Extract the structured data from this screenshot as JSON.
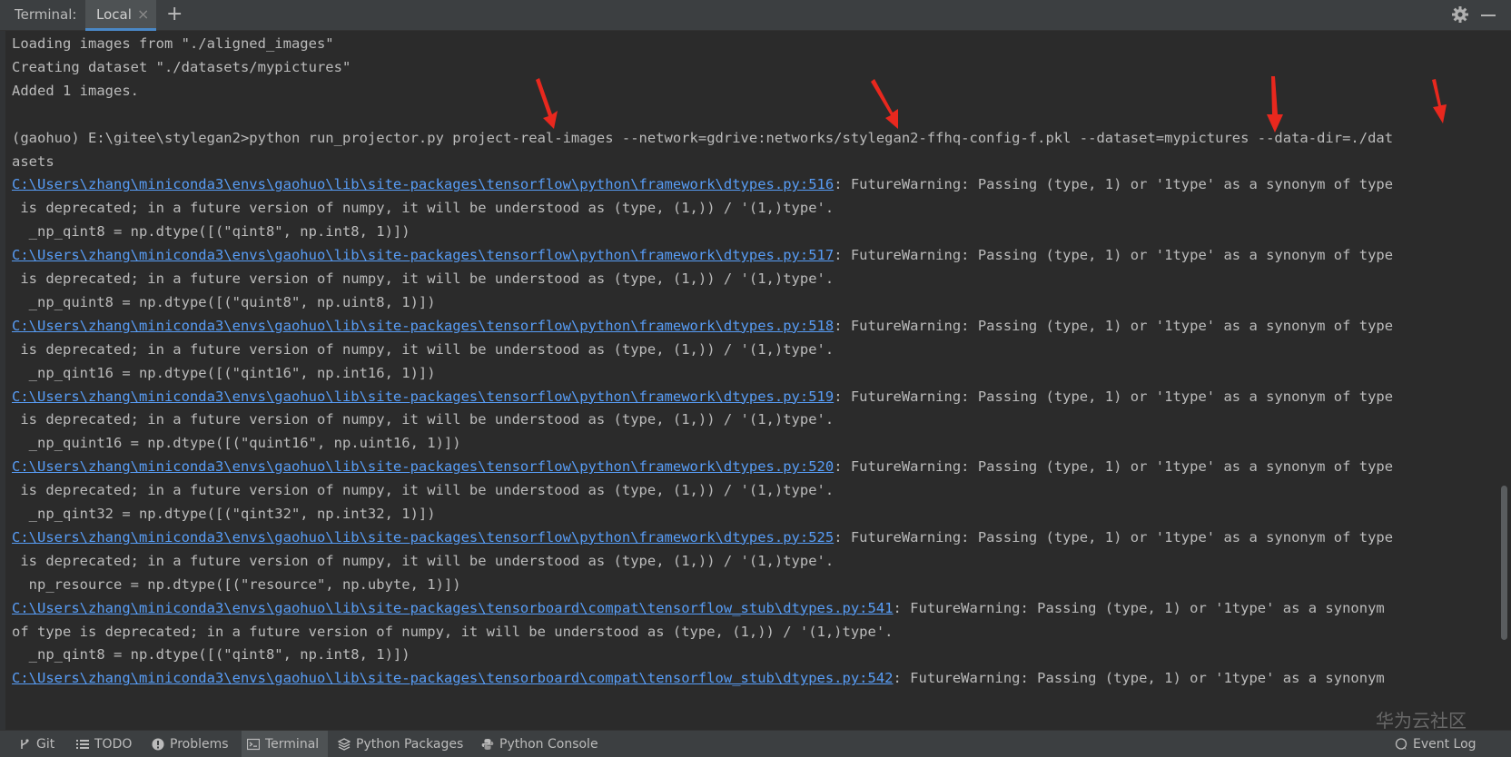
{
  "header": {
    "title": "Terminal:",
    "tab_label": "Local",
    "close_glyph": "×",
    "add_glyph": "+"
  },
  "output": {
    "lines": [
      {
        "text": "Loading images from \"./aligned_images\""
      },
      {
        "text": "Creating dataset \"./datasets/mypictures\""
      },
      {
        "text": "Added 1 images."
      },
      {
        "text": ""
      },
      {
        "text": "(gaohuo) E:\\gitee\\stylegan2>python run_projector.py project-real-images --network=gdrive:networks/stylegan2-ffhq-config-f.pkl --dataset=mypictures --data-dir=./dat"
      },
      {
        "text": "asets"
      },
      {
        "link": "C:\\Users\\zhang\\miniconda3\\envs\\gaohuo\\lib\\site-packages\\tensorflow\\python\\framework\\dtypes.py:516",
        "text": ": FutureWarning: Passing (type, 1) or '1type' as a synonym of type"
      },
      {
        "text": " is deprecated; in a future version of numpy, it will be understood as (type, (1,)) / '(1,)type'."
      },
      {
        "text": "  _np_qint8 = np.dtype([(\"qint8\", np.int8, 1)])"
      },
      {
        "link": "C:\\Users\\zhang\\miniconda3\\envs\\gaohuo\\lib\\site-packages\\tensorflow\\python\\framework\\dtypes.py:517",
        "text": ": FutureWarning: Passing (type, 1) or '1type' as a synonym of type"
      },
      {
        "text": " is deprecated; in a future version of numpy, it will be understood as (type, (1,)) / '(1,)type'."
      },
      {
        "text": "  _np_quint8 = np.dtype([(\"quint8\", np.uint8, 1)])"
      },
      {
        "link": "C:\\Users\\zhang\\miniconda3\\envs\\gaohuo\\lib\\site-packages\\tensorflow\\python\\framework\\dtypes.py:518",
        "text": ": FutureWarning: Passing (type, 1) or '1type' as a synonym of type"
      },
      {
        "text": " is deprecated; in a future version of numpy, it will be understood as (type, (1,)) / '(1,)type'."
      },
      {
        "text": "  _np_qint16 = np.dtype([(\"qint16\", np.int16, 1)])"
      },
      {
        "link": "C:\\Users\\zhang\\miniconda3\\envs\\gaohuo\\lib\\site-packages\\tensorflow\\python\\framework\\dtypes.py:519",
        "text": ": FutureWarning: Passing (type, 1) or '1type' as a synonym of type"
      },
      {
        "text": " is deprecated; in a future version of numpy, it will be understood as (type, (1,)) / '(1,)type'."
      },
      {
        "text": "  _np_quint16 = np.dtype([(\"quint16\", np.uint16, 1)])"
      },
      {
        "link": "C:\\Users\\zhang\\miniconda3\\envs\\gaohuo\\lib\\site-packages\\tensorflow\\python\\framework\\dtypes.py:520",
        "text": ": FutureWarning: Passing (type, 1) or '1type' as a synonym of type"
      },
      {
        "text": " is deprecated; in a future version of numpy, it will be understood as (type, (1,)) / '(1,)type'."
      },
      {
        "text": "  _np_qint32 = np.dtype([(\"qint32\", np.int32, 1)])"
      },
      {
        "link": "C:\\Users\\zhang\\miniconda3\\envs\\gaohuo\\lib\\site-packages\\tensorflow\\python\\framework\\dtypes.py:525",
        "text": ": FutureWarning: Passing (type, 1) or '1type' as a synonym of type"
      },
      {
        "text": " is deprecated; in a future version of numpy, it will be understood as (type, (1,)) / '(1,)type'."
      },
      {
        "text": "  np_resource = np.dtype([(\"resource\", np.ubyte, 1)])"
      },
      {
        "link": "C:\\Users\\zhang\\miniconda3\\envs\\gaohuo\\lib\\site-packages\\tensorboard\\compat\\tensorflow_stub\\dtypes.py:541",
        "text": ": FutureWarning: Passing (type, 1) or '1type' as a synonym"
      },
      {
        "text": "of type is deprecated; in a future version of numpy, it will be understood as (type, (1,)) / '(1,)type'."
      },
      {
        "text": "  _np_qint8 = np.dtype([(\"qint8\", np.int8, 1)])"
      },
      {
        "link": "C:\\Users\\zhang\\miniconda3\\envs\\gaohuo\\lib\\site-packages\\tensorboard\\compat\\tensorflow_stub\\dtypes.py:542",
        "text": ": FutureWarning: Passing (type, 1) or '1type' as a synonym"
      }
    ]
  },
  "bottom_bar": {
    "tabs": [
      {
        "label": "Git",
        "icon": "git-branch-icon"
      },
      {
        "label": "TODO",
        "icon": "list-icon"
      },
      {
        "label": "Problems",
        "icon": "info-icon"
      },
      {
        "label": "Terminal",
        "icon": "terminal-icon"
      },
      {
        "label": "Python Packages",
        "icon": "layers-icon"
      },
      {
        "label": "Python Console",
        "icon": "python-icon"
      }
    ],
    "event_log": "Event Log"
  },
  "watermark": "华为云社区",
  "colors": {
    "background": "#2b2b2b",
    "text": "#bbbbbb",
    "link": "#589df6",
    "arrow": "#e8281e",
    "accent": "#4a88c7"
  }
}
